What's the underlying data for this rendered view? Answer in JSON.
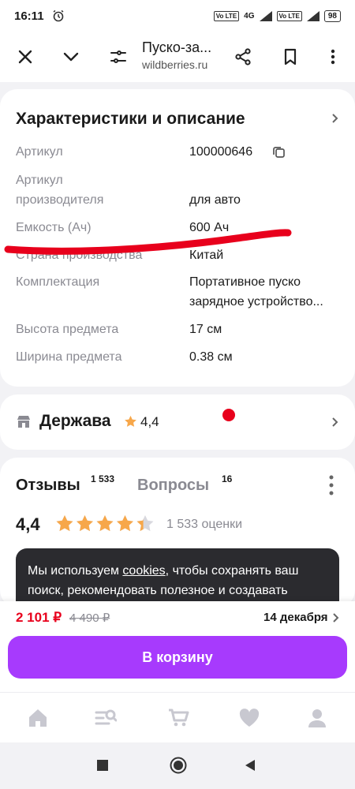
{
  "status_bar": {
    "time": "16:11",
    "net_badge_1": "Vo LTE",
    "net_badge_2": "Vo LTE",
    "net_type": "4G",
    "battery": "98"
  },
  "top_bar": {
    "title": "Пуско-за...",
    "domain": "wildberries.ru",
    "icons": [
      "close-icon",
      "chevron-down-icon",
      "filter-icon",
      "share-icon",
      "bookmark-icon",
      "more-vert-icon"
    ]
  },
  "characteristics": {
    "title": "Характеристики и описание",
    "rows": [
      {
        "label": "Артикул",
        "value": "100000646"
      },
      {
        "label": "Артикул производителя",
        "value": "для авто"
      },
      {
        "label": "Емкость (Ач)",
        "value": "600 Ач"
      },
      {
        "label": "Страна производства",
        "value": "Китай"
      },
      {
        "label": "Комплектация",
        "value": "Портативное пуско зарядное устройство..."
      },
      {
        "label": "Высота предмета",
        "value": "17 см"
      },
      {
        "label": "Ширина предмета",
        "value": "0.38 см"
      }
    ]
  },
  "shop": {
    "name": "Держава",
    "rating": "4,4"
  },
  "reviews": {
    "tab_reviews": "Отзывы",
    "reviews_count": "1 533",
    "tab_questions": "Вопросы",
    "questions_count": "16",
    "rating": "4,4",
    "stars_value": 4.4,
    "rating_count": "1 533 оценки"
  },
  "cookie_banner": {
    "text_before": "Мы используем ",
    "link": "cookies",
    "text_after": ", чтобы сохранять ваш поиск, рекомендовать полезное и создавать"
  },
  "purchase": {
    "price": "2 101 ₽",
    "old_price": "4 490 ₽",
    "delivery_date": "14 декабря",
    "cart_button": "В корзину"
  },
  "bottom_nav": [
    "home-icon",
    "catalog-search-icon",
    "cart-icon",
    "favorites-icon",
    "profile-icon"
  ],
  "colors": {
    "accent": "#a73afd",
    "price_red": "#e8001c",
    "star": "#f7a74a",
    "annotation_red": "#e8001c"
  }
}
